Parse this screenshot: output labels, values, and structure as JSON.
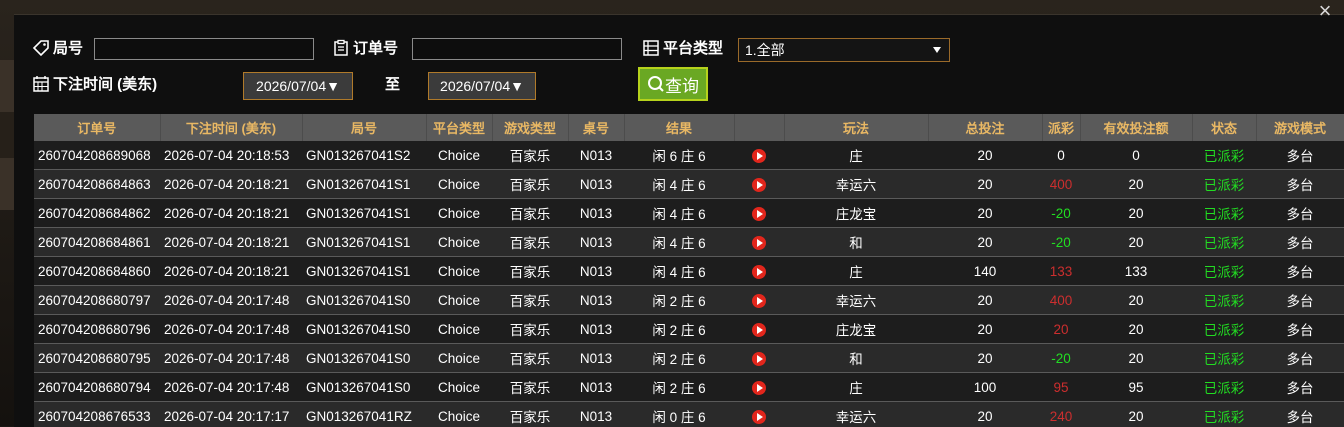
{
  "colors": {
    "header_text": "#e9b864",
    "positive": "#22dd22",
    "negative": "#cc2e2e",
    "neutral": "#ffffff",
    "status": "#22dd22",
    "accent_button": "#6aa823"
  },
  "dialog": {
    "close_icon": "×"
  },
  "filters": {
    "round_label": "局号",
    "round_value": "",
    "order_label": "订单号",
    "order_value": "",
    "platform_label": "平台类型",
    "platform_selected": "1.全部",
    "time_label": "下注时间 (美东)",
    "date_from": "2026/07/04",
    "to_label": "至",
    "date_to": "2026/07/04",
    "query_label": "查询"
  },
  "table": {
    "columns": [
      "订单号",
      "下注时间 (美东)",
      "局号",
      "平台类型",
      "游戏类型",
      "桌号",
      "结果",
      "",
      "玩法",
      "总投注",
      "派彩",
      "有效投注额",
      "状态",
      "游戏模式"
    ],
    "rows": [
      {
        "order": "260704208689068",
        "time": "2026-07-04 20:18:53",
        "round": "GN013267041S2",
        "platform": "Choice",
        "game": "百家乐",
        "table": "N013",
        "result": "闲 6 庄 6",
        "play": "庄",
        "bet": "20",
        "payout": "0",
        "payout_sign": "zero",
        "valid": "0",
        "status": "已派彩",
        "mode": "多台"
      },
      {
        "order": "260704208684863",
        "time": "2026-07-04 20:18:21",
        "round": "GN013267041S1",
        "platform": "Choice",
        "game": "百家乐",
        "table": "N013",
        "result": "闲 4 庄 6",
        "play": "幸运六",
        "bet": "20",
        "payout": "400",
        "payout_sign": "neg",
        "valid": "20",
        "status": "已派彩",
        "mode": "多台"
      },
      {
        "order": "260704208684862",
        "time": "2026-07-04 20:18:21",
        "round": "GN013267041S1",
        "platform": "Choice",
        "game": "百家乐",
        "table": "N013",
        "result": "闲 4 庄 6",
        "play": "庄龙宝",
        "bet": "20",
        "payout": "-20",
        "payout_sign": "pos",
        "valid": "20",
        "status": "已派彩",
        "mode": "多台"
      },
      {
        "order": "260704208684861",
        "time": "2026-07-04 20:18:21",
        "round": "GN013267041S1",
        "platform": "Choice",
        "game": "百家乐",
        "table": "N013",
        "result": "闲 4 庄 6",
        "play": "和",
        "bet": "20",
        "payout": "-20",
        "payout_sign": "pos",
        "valid": "20",
        "status": "已派彩",
        "mode": "多台"
      },
      {
        "order": "260704208684860",
        "time": "2026-07-04 20:18:21",
        "round": "GN013267041S1",
        "platform": "Choice",
        "game": "百家乐",
        "table": "N013",
        "result": "闲 4 庄 6",
        "play": "庄",
        "bet": "140",
        "payout": "133",
        "payout_sign": "neg",
        "valid": "133",
        "status": "已派彩",
        "mode": "多台"
      },
      {
        "order": "260704208680797",
        "time": "2026-07-04 20:17:48",
        "round": "GN013267041S0",
        "platform": "Choice",
        "game": "百家乐",
        "table": "N013",
        "result": "闲 2 庄 6",
        "play": "幸运六",
        "bet": "20",
        "payout": "400",
        "payout_sign": "neg",
        "valid": "20",
        "status": "已派彩",
        "mode": "多台"
      },
      {
        "order": "260704208680796",
        "time": "2026-07-04 20:17:48",
        "round": "GN013267041S0",
        "platform": "Choice",
        "game": "百家乐",
        "table": "N013",
        "result": "闲 2 庄 6",
        "play": "庄龙宝",
        "bet": "20",
        "payout": "20",
        "payout_sign": "neg",
        "valid": "20",
        "status": "已派彩",
        "mode": "多台"
      },
      {
        "order": "260704208680795",
        "time": "2026-07-04 20:17:48",
        "round": "GN013267041S0",
        "platform": "Choice",
        "game": "百家乐",
        "table": "N013",
        "result": "闲 2 庄 6",
        "play": "和",
        "bet": "20",
        "payout": "-20",
        "payout_sign": "pos",
        "valid": "20",
        "status": "已派彩",
        "mode": "多台"
      },
      {
        "order": "260704208680794",
        "time": "2026-07-04 20:17:48",
        "round": "GN013267041S0",
        "platform": "Choice",
        "game": "百家乐",
        "table": "N013",
        "result": "闲 2 庄 6",
        "play": "庄",
        "bet": "100",
        "payout": "95",
        "payout_sign": "neg",
        "valid": "95",
        "status": "已派彩",
        "mode": "多台"
      },
      {
        "order": "260704208676533",
        "time": "2026-07-04 20:17:17",
        "round": "GN013267041RZ",
        "platform": "Choice",
        "game": "百家乐",
        "table": "N013",
        "result": "闲 0 庄 6",
        "play": "幸运六",
        "bet": "20",
        "payout": "240",
        "payout_sign": "neg",
        "valid": "20",
        "status": "已派彩",
        "mode": "多台"
      }
    ]
  }
}
